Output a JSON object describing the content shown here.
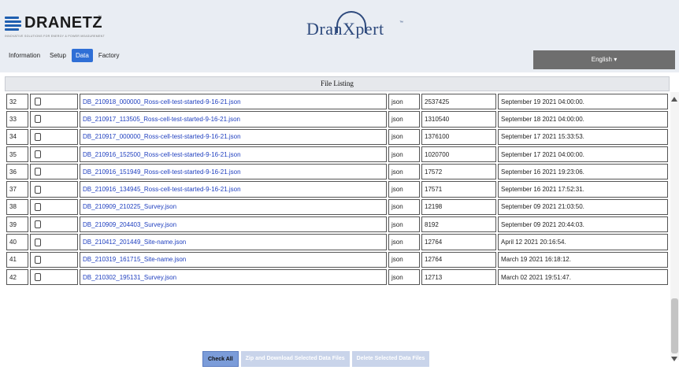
{
  "brand": {
    "dranetz_text": "DRANETZ",
    "dranetz_tm": "™",
    "dranetz_tagline": "INNOVATIVE SOLUTIONS FOR ENERGY & POWER MEASUREMENT",
    "product_text": "DranXpert",
    "product_tm": "™"
  },
  "nav": {
    "tabs": [
      {
        "label": "Information"
      },
      {
        "label": "Setup"
      },
      {
        "label": "Data",
        "active": true
      },
      {
        "label": "Factory"
      }
    ],
    "language_button": "English ▾"
  },
  "listing": {
    "title": "File Listing",
    "rows": [
      {
        "num": "32",
        "name": "DB_210918_000000_Ross-cell-test-started-9-16-21.json",
        "type": "json",
        "size": "2537425",
        "date": "September 19 2021 04:00:00."
      },
      {
        "num": "33",
        "name": "DB_210917_113505_Ross-cell-test-started-9-16-21.json",
        "type": "json",
        "size": "1310540",
        "date": "September 18 2021 04:00:00."
      },
      {
        "num": "34",
        "name": "DB_210917_000000_Ross-cell-test-started-9-16-21.json",
        "type": "json",
        "size": "1376100",
        "date": "September 17 2021 15:33:53."
      },
      {
        "num": "35",
        "name": "DB_210916_152500_Ross-cell-test-started-9-16-21.json",
        "type": "json",
        "size": "1020700",
        "date": "September 17 2021 04:00:00."
      },
      {
        "num": "36",
        "name": "DB_210916_151949_Ross-cell-test-started-9-16-21.json",
        "type": "json",
        "size": "17572",
        "date": "September 16 2021 19:23:06."
      },
      {
        "num": "37",
        "name": "DB_210916_134945_Ross-cell-test-started-9-16-21.json",
        "type": "json",
        "size": "17571",
        "date": "September 16 2021 17:52:31."
      },
      {
        "num": "38",
        "name": "DB_210909_210225_Survey.json",
        "type": "json",
        "size": "12198",
        "date": "September 09 2021 21:03:50."
      },
      {
        "num": "39",
        "name": "DB_210909_204403_Survey.json",
        "type": "json",
        "size": "8192",
        "date": "September 09 2021 20:44:03."
      },
      {
        "num": "40",
        "name": "DB_210412_201449_Site-name.json",
        "type": "json",
        "size": "12764",
        "date": "April 12 2021 20:16:54."
      },
      {
        "num": "41",
        "name": "DB_210319_161715_Site-name.json",
        "type": "json",
        "size": "12764",
        "date": "March 19 2021 16:18:12."
      },
      {
        "num": "42",
        "name": "DB_210302_195131_Survey.json",
        "type": "json",
        "size": "12713",
        "date": "March 02 2021 19:51:47."
      }
    ]
  },
  "actions": {
    "check_all": "Check All",
    "zip_download": "Zip and Download Selected Data Files",
    "delete_selected": "Delete Selected Data Files"
  },
  "colors": {
    "active_tab": "#2f6fd6",
    "link": "#1f3fbf",
    "language_button": "#6e6e6e",
    "header_bg": "#e9edf3"
  }
}
